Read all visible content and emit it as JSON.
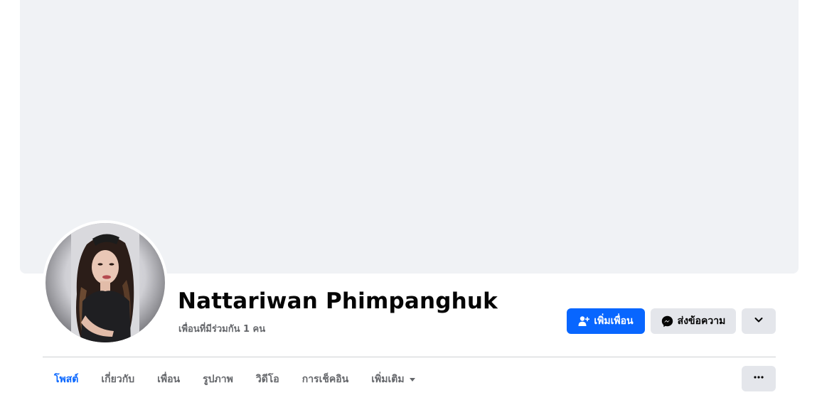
{
  "profile": {
    "name": "Nattariwan Phimpanghuk",
    "mutual_friends": "เพื่อนที่มีร่วมกัน 1 คน"
  },
  "actions": {
    "add_friend_label": "เพิ่มเพื่อน",
    "message_label": "ส่งข้อความ",
    "add_friend_icon": "add-friend-icon",
    "message_icon": "messenger-icon",
    "more_icon": "chevron-down-icon"
  },
  "tabs": [
    {
      "label": "โพสต์",
      "active": true
    },
    {
      "label": "เกี่ยวกับ",
      "active": false
    },
    {
      "label": "เพื่อน",
      "active": false
    },
    {
      "label": "รูปภาพ",
      "active": false
    },
    {
      "label": "วิดีโอ",
      "active": false
    },
    {
      "label": "การเช็คอิน",
      "active": false
    },
    {
      "label": "เพิ่มเติม",
      "active": false
    }
  ],
  "tab_more_icon": "ellipsis-icon",
  "colors": {
    "accent": "#0866ff",
    "cover": "#f0f2f5",
    "secondary_button": "#e4e6eb",
    "secondary_text": "#65676b"
  }
}
